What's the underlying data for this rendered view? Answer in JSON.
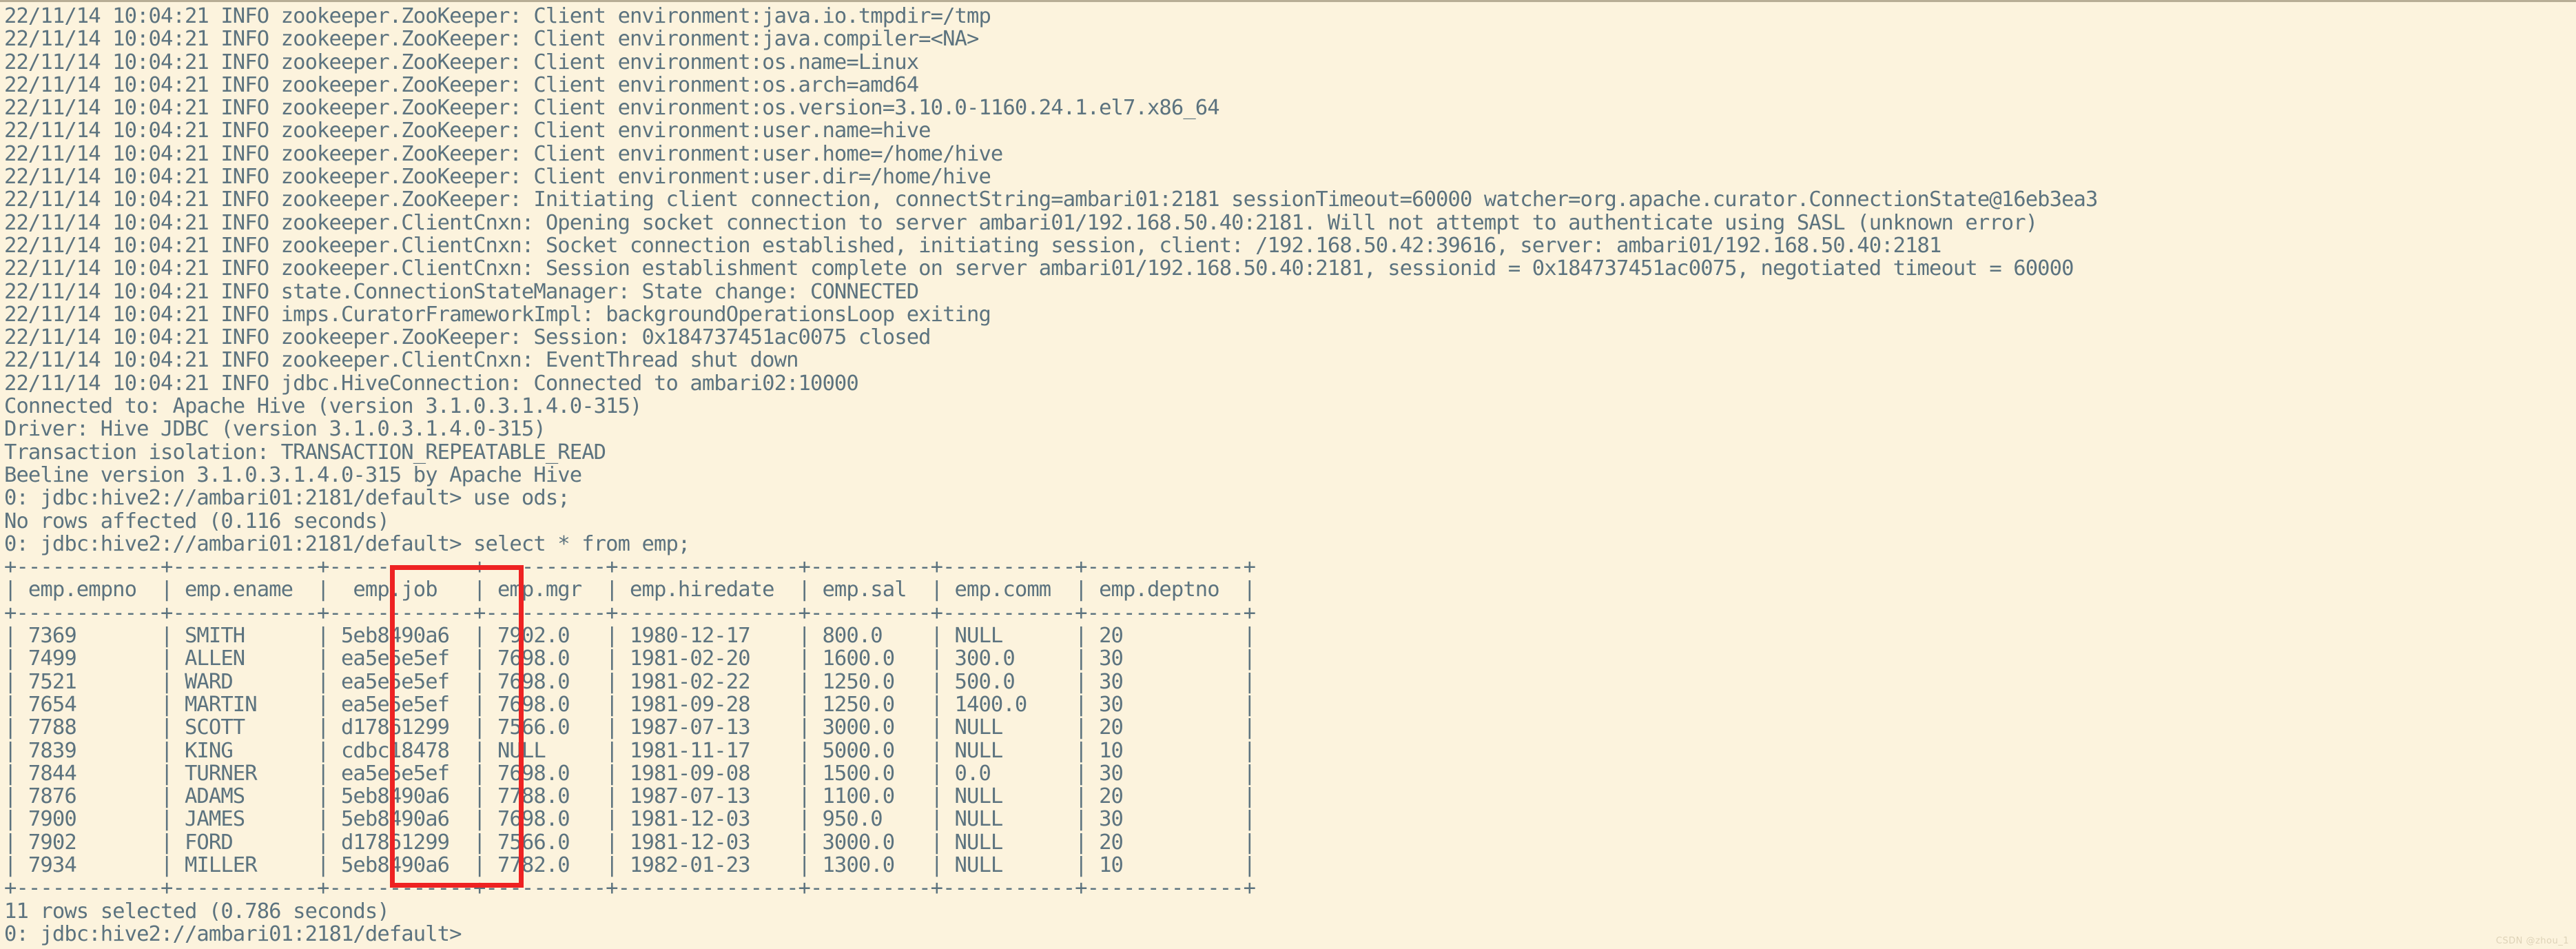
{
  "terminal": {
    "background_color": "#fcf3dd",
    "text_color": "#5c737f",
    "highlight_color": "#ee2222",
    "watermark": "CSDN @zhou_1",
    "lines": [
      "22/11/14 10:04:21 INFO zookeeper.ZooKeeper: Client environment:java.io.tmpdir=/tmp",
      "22/11/14 10:04:21 INFO zookeeper.ZooKeeper: Client environment:java.compiler=<NA>",
      "22/11/14 10:04:21 INFO zookeeper.ZooKeeper: Client environment:os.name=Linux",
      "22/11/14 10:04:21 INFO zookeeper.ZooKeeper: Client environment:os.arch=amd64",
      "22/11/14 10:04:21 INFO zookeeper.ZooKeeper: Client environment:os.version=3.10.0-1160.24.1.el7.x86_64",
      "22/11/14 10:04:21 INFO zookeeper.ZooKeeper: Client environment:user.name=hive",
      "22/11/14 10:04:21 INFO zookeeper.ZooKeeper: Client environment:user.home=/home/hive",
      "22/11/14 10:04:21 INFO zookeeper.ZooKeeper: Client environment:user.dir=/home/hive",
      "22/11/14 10:04:21 INFO zookeeper.ZooKeeper: Initiating client connection, connectString=ambari01:2181 sessionTimeout=60000 watcher=org.apache.curator.ConnectionState@16eb3ea3",
      "22/11/14 10:04:21 INFO zookeeper.ClientCnxn: Opening socket connection to server ambari01/192.168.50.40:2181. Will not attempt to authenticate using SASL (unknown error)",
      "22/11/14 10:04:21 INFO zookeeper.ClientCnxn: Socket connection established, initiating session, client: /192.168.50.42:39616, server: ambari01/192.168.50.40:2181",
      "22/11/14 10:04:21 INFO zookeeper.ClientCnxn: Session establishment complete on server ambari01/192.168.50.40:2181, sessionid = 0x184737451ac0075, negotiated timeout = 60000",
      "22/11/14 10:04:21 INFO state.ConnectionStateManager: State change: CONNECTED",
      "22/11/14 10:04:21 INFO imps.CuratorFrameworkImpl: backgroundOperationsLoop exiting",
      "22/11/14 10:04:21 INFO zookeeper.ZooKeeper: Session: 0x184737451ac0075 closed",
      "22/11/14 10:04:21 INFO zookeeper.ClientCnxn: EventThread shut down",
      "22/11/14 10:04:21 INFO jdbc.HiveConnection: Connected to ambari02:10000",
      "Connected to: Apache Hive (version 3.1.0.3.1.4.0-315)",
      "Driver: Hive JDBC (version 3.1.0.3.1.4.0-315)",
      "Transaction isolation: TRANSACTION_REPEATABLE_READ",
      "Beeline version 3.1.0.3.1.4.0-315 by Apache Hive",
      "0: jdbc:hive2://ambari01:2181/default> use ods;",
      "No rows affected (0.116 seconds)",
      "0: jdbc:hive2://ambari01:2181/default> select * from emp;",
      "+------------+------------+------------+----------+---------------+----------+-----------+-------------+",
      "| emp.empno  | emp.ename  |  emp.job   | emp.mgr  | emp.hiredate  | emp.sal  | emp.comm  | emp.deptno  |",
      "+------------+------------+------------+----------+---------------+----------+-----------+-------------+",
      "| 7369       | SMITH      | 5eb8490a6  | 7902.0   | 1980-12-17    | 800.0    | NULL      | 20          |",
      "| 7499       | ALLEN      | ea5e5e5ef  | 7698.0   | 1981-02-20    | 1600.0   | 300.0     | 30          |",
      "| 7521       | WARD       | ea5e5e5ef  | 7698.0   | 1981-02-22    | 1250.0   | 500.0     | 30          |",
      "| 7654       | MARTIN     | ea5e5e5ef  | 7698.0   | 1981-09-28    | 1250.0   | 1400.0    | 30          |",
      "| 7788       | SCOTT      | d17861299  | 7566.0   | 1987-07-13    | 3000.0   | NULL      | 20          |",
      "| 7839       | KING       | cdbc18478  | NULL     | 1981-11-17    | 5000.0   | NULL      | 10          |",
      "| 7844       | TURNER     | ea5e5e5ef  | 7698.0   | 1981-09-08    | 1500.0   | 0.0       | 30          |",
      "| 7876       | ADAMS      | 5eb8490a6  | 7788.0   | 1987-07-13    | 1100.0   | NULL      | 20          |",
      "| 7900       | JAMES      | 5eb8490a6  | 7698.0   | 1981-12-03    | 950.0    | NULL      | 30          |",
      "| 7902       | FORD       | d17861299  | 7566.0   | 1981-12-03    | 3000.0   | NULL      | 20          |",
      "| 7934       | MILLER     | 5eb8490a6  | 7782.0   | 1982-01-23    | 1300.0   | NULL      | 10          |",
      "+------------+------------+------------+----------+---------------+----------+-----------+-------------+",
      "11 rows selected (0.786 seconds)",
      "0: jdbc:hive2://ambari01:2181/default>"
    ]
  },
  "query_result": {
    "prompt": "0: jdbc:hive2://ambari01:2181/default>",
    "database_command": "use ods;",
    "database_command_result": "No rows affected (0.116 seconds)",
    "select_command": "select * from emp;",
    "row_count_message": "11 rows selected (0.786 seconds)",
    "highlighted_column": "emp.job",
    "columns": [
      "emp.empno",
      "emp.ename",
      "emp.job",
      "emp.mgr",
      "emp.hiredate",
      "emp.sal",
      "emp.comm",
      "emp.deptno"
    ],
    "rows": [
      [
        "7369",
        "SMITH",
        "5eb8490a6",
        "7902.0",
        "1980-12-17",
        "800.0",
        "NULL",
        "20"
      ],
      [
        "7499",
        "ALLEN",
        "ea5e5e5ef",
        "7698.0",
        "1981-02-20",
        "1600.0",
        "300.0",
        "30"
      ],
      [
        "7521",
        "WARD",
        "ea5e5e5ef",
        "7698.0",
        "1981-02-22",
        "1250.0",
        "500.0",
        "30"
      ],
      [
        "7654",
        "MARTIN",
        "ea5e5e5ef",
        "7698.0",
        "1981-09-28",
        "1250.0",
        "1400.0",
        "30"
      ],
      [
        "7788",
        "SCOTT",
        "d17861299",
        "7566.0",
        "1987-07-13",
        "3000.0",
        "NULL",
        "20"
      ],
      [
        "7839",
        "KING",
        "cdbc18478",
        "NULL",
        "1981-11-17",
        "5000.0",
        "NULL",
        "10"
      ],
      [
        "7844",
        "TURNER",
        "ea5e5e5ef",
        "7698.0",
        "1981-09-08",
        "1500.0",
        "0.0",
        "30"
      ],
      [
        "7876",
        "ADAMS",
        "5eb8490a6",
        "7788.0",
        "1987-07-13",
        "1100.0",
        "NULL",
        "20"
      ],
      [
        "7900",
        "JAMES",
        "5eb8490a6",
        "7698.0",
        "1981-12-03",
        "950.0",
        "NULL",
        "30"
      ],
      [
        "7902",
        "FORD",
        "d17861299",
        "7566.0",
        "1981-12-03",
        "3000.0",
        "NULL",
        "20"
      ],
      [
        "7934",
        "MILLER",
        "5eb8490a6",
        "7782.0",
        "1982-01-23",
        "1300.0",
        "NULL",
        "10"
      ]
    ]
  },
  "connection": {
    "hive_version": "3.1.0.3.1.4.0-315",
    "jdbc_driver_version": "3.1.0.3.1.4.0-315",
    "beeline_version": "3.1.0.3.1.4.0-315",
    "transaction_isolation": "TRANSACTION_REPEATABLE_READ",
    "hiveserver": "ambari02:10000",
    "zookeeper_quorum": "ambari01:2181",
    "session_id": "0x184737451ac0075",
    "session_timeout": "60000",
    "negotiated_timeout": "60000",
    "client_address": "/192.168.50.42:39616",
    "server_address": "ambari01/192.168.50.40:2181"
  }
}
